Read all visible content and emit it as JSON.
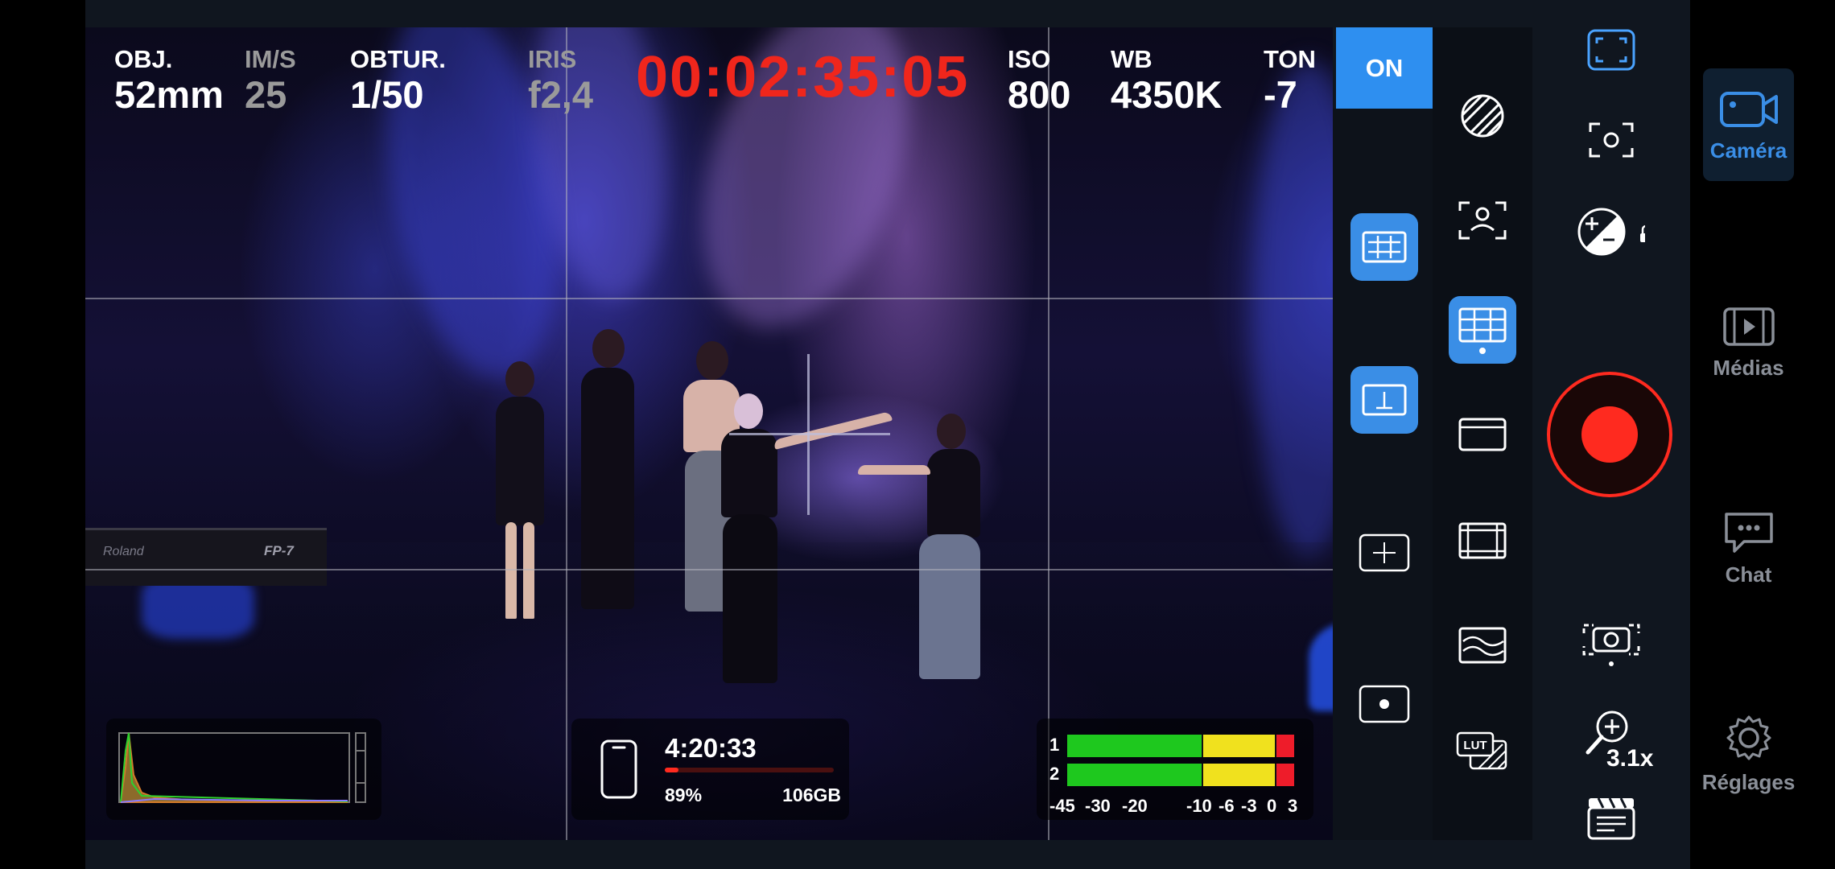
{
  "hud": {
    "lens": {
      "label": "OBJ.",
      "value": "52mm"
    },
    "fps": {
      "label": "IM/S",
      "value": "25"
    },
    "shutter": {
      "label": "OBTUR.",
      "value": "1/50"
    },
    "iris": {
      "label": "IRIS",
      "value": "f2,4"
    },
    "timecode": "00:02:35:05",
    "iso": {
      "label": "ISO",
      "value": "800"
    },
    "wb": {
      "label": "WB",
      "value": "4350K"
    },
    "tint": {
      "label": "TON",
      "value": "-7"
    },
    "on_button": "ON"
  },
  "storage": {
    "remaining_time": "4:20:33",
    "percent": "89%",
    "size": "106GB",
    "used_fraction": 0.08
  },
  "audio": {
    "channels": [
      "1",
      "2"
    ],
    "scale": [
      "-45",
      "-30",
      "-20",
      "-10",
      "-6",
      "-3",
      "0",
      "3"
    ]
  },
  "scene_text": {
    "keyboard_brand": "Roland",
    "keyboard_model": "FP-7"
  },
  "tools": {
    "lut_label": "LUT"
  },
  "zoom": {
    "value": "3.1x"
  },
  "nav": {
    "items": [
      {
        "label": "Caméra",
        "active": true
      },
      {
        "label": "Médias",
        "active": false
      },
      {
        "label": "Chat",
        "active": false
      },
      {
        "label": "Réglages",
        "active": false
      }
    ]
  },
  "colors": {
    "accent": "#3a8ee6",
    "record": "#ff2a1f",
    "timecode": "#f0261c",
    "meter_green": "#1ec81e",
    "meter_yellow": "#f0e11e",
    "meter_red": "#ee1c2a"
  }
}
